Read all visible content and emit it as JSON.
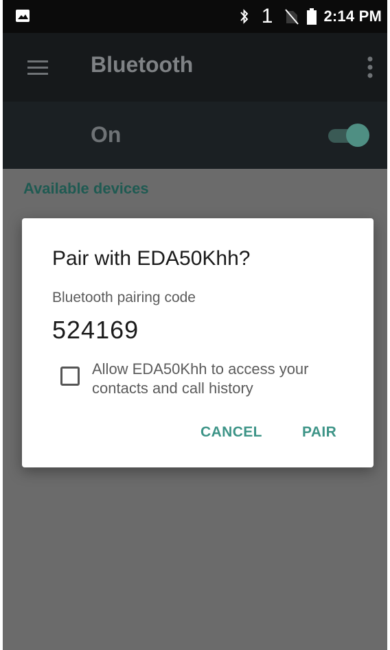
{
  "status_bar": {
    "time": "2:14 PM",
    "notification_count": "1",
    "icons": [
      "image-icon",
      "bluetooth-icon",
      "no-sim-icon",
      "battery-icon"
    ]
  },
  "toolbar": {
    "title": "Bluetooth",
    "icons": [
      "menu-icon",
      "overflow-menu-icon"
    ]
  },
  "switch": {
    "label": "On",
    "state": "on"
  },
  "section_header": "Available devices",
  "dialog": {
    "title": "Pair with EDA50Khh?",
    "subtitle": "Bluetooth pairing code",
    "code": "524169",
    "checkbox_label": "Allow EDA50Khh to access your contacts and call history",
    "checkbox_checked": false,
    "cancel_label": "CANCEL",
    "pair_label": "PAIR"
  },
  "colors": {
    "accent": "#3d9487",
    "status_bar": "#0b0b0b",
    "toolbar": "#16191b",
    "scrim": "#6b6b6b"
  }
}
